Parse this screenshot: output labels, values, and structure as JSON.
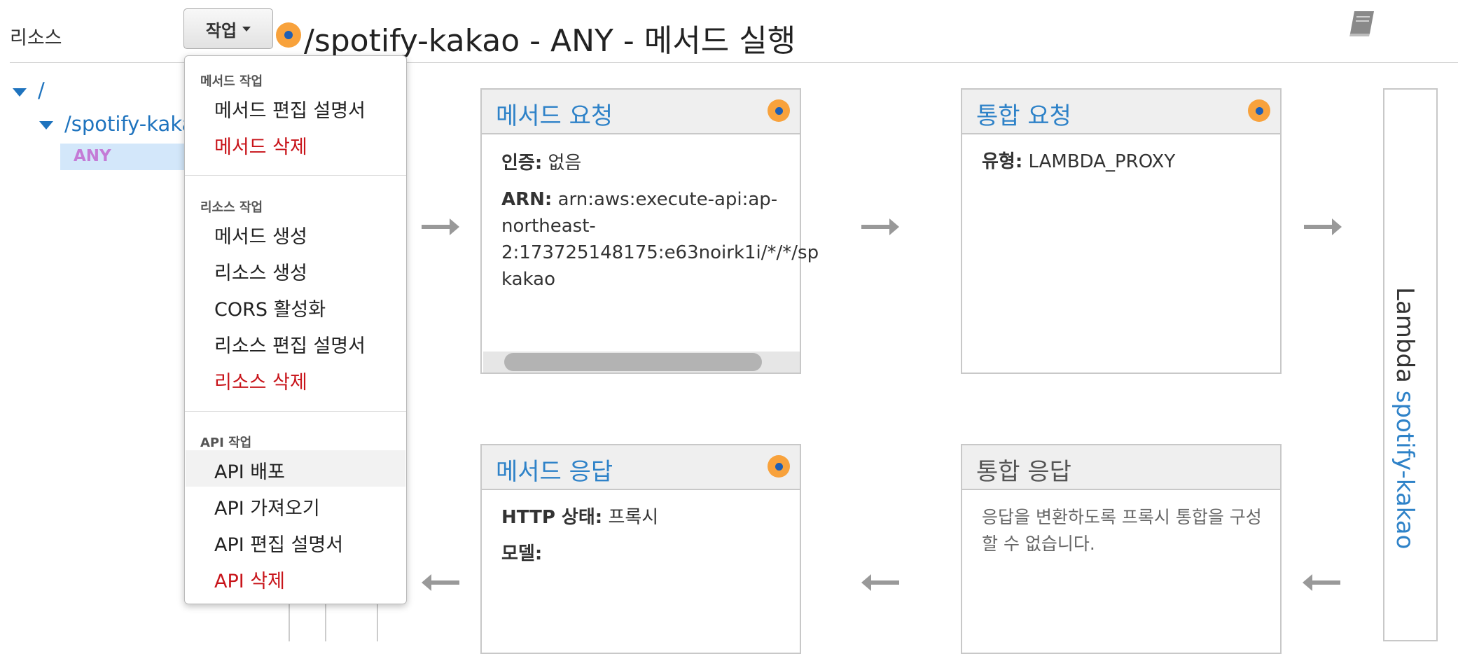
{
  "sidebar": {
    "label": "리소스",
    "actions_button": "작업",
    "tree": {
      "root": "/",
      "child": "/spotify-kaka",
      "method": "ANY"
    }
  },
  "header": {
    "title": "/spotify-kakao - ANY - 메서드 실행"
  },
  "menu": {
    "sections": [
      {
        "heading": "메서드 작업",
        "items": [
          {
            "label": "메서드 편집 설명서",
            "danger": false
          },
          {
            "label": "메서드 삭제",
            "danger": true
          }
        ]
      },
      {
        "heading": "리소스 작업",
        "items": [
          {
            "label": "메서드 생성",
            "danger": false
          },
          {
            "label": "리소스 생성",
            "danger": false
          },
          {
            "label": "CORS 활성화",
            "danger": false
          },
          {
            "label": "리소스 편집 설명서",
            "danger": false
          },
          {
            "label": "리소스 삭제",
            "danger": true
          }
        ]
      },
      {
        "heading": "API 작업",
        "items": [
          {
            "label": "API 배포",
            "danger": false,
            "hovered": true
          },
          {
            "label": "API 가져오기",
            "danger": false
          },
          {
            "label": "API 편집 설명서",
            "danger": false
          },
          {
            "label": "API 삭제",
            "danger": true
          }
        ]
      }
    ]
  },
  "cards": {
    "method_request": {
      "title": "메서드 요청",
      "auth_label": "인증:",
      "auth_value": "없음",
      "arn_label": "ARN:",
      "arn_line1": "arn:aws:execute-api:ap-",
      "arn_line2": "northeast-",
      "arn_line3": "2:173725148175:e63noirk1i/*/*/sp",
      "arn_line4": "kakao"
    },
    "integration_request": {
      "title": "통합 요청",
      "type_label": "유형:",
      "type_value": "LAMBDA_PROXY"
    },
    "method_response": {
      "title": "메서드 응답",
      "status_label": "HTTP 상태:",
      "status_value": "프록시",
      "model_label": "모델:"
    },
    "integration_response": {
      "title": "통합 응답",
      "message_line1": "응답을 변환하도록 프록시 통합을 구성",
      "message_line2": "할 수 없습니다."
    }
  },
  "lambda": {
    "prefix": "Lambda",
    "name": "spotify-kakao"
  },
  "colors": {
    "link": "#1e73be",
    "card_title": "#2e82c8",
    "status_dot": "#f8a23c",
    "danger": "#c8141a",
    "selected_row": "#d3e7fa",
    "method_badge": "#c47bd6"
  }
}
